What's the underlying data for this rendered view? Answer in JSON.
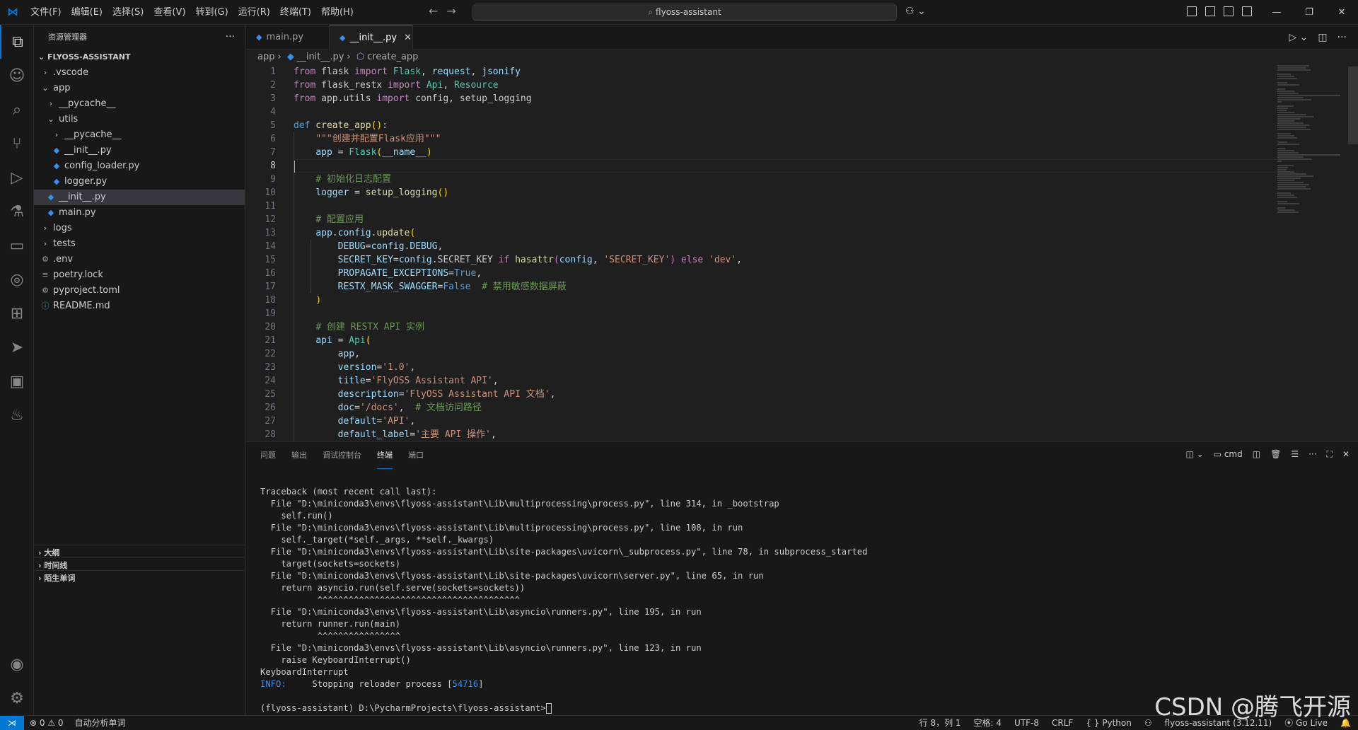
{
  "menus": [
    "文件(F)",
    "编辑(E)",
    "选择(S)",
    "查看(V)",
    "转到(G)",
    "运行(R)",
    "终端(T)",
    "帮助(H)"
  ],
  "search": {
    "text": "flyoss-assistant"
  },
  "sidebar": {
    "title": "资源管理器",
    "root": "FLYOSS-ASSISTANT",
    "items": [
      {
        "label": ".vscode",
        "depth": 1,
        "type": "folder",
        "open": false
      },
      {
        "label": "app",
        "depth": 1,
        "type": "folder",
        "open": true
      },
      {
        "label": "__pycache__",
        "depth": 2,
        "type": "folder",
        "open": false
      },
      {
        "label": "utils",
        "depth": 2,
        "type": "folder",
        "open": true
      },
      {
        "label": "__pycache__",
        "depth": 3,
        "type": "folder",
        "open": false
      },
      {
        "label": "__init__.py",
        "depth": 3,
        "type": "py"
      },
      {
        "label": "config_loader.py",
        "depth": 3,
        "type": "py"
      },
      {
        "label": "logger.py",
        "depth": 3,
        "type": "py"
      },
      {
        "label": "__init__.py",
        "depth": 2,
        "type": "py",
        "selected": true
      },
      {
        "label": "main.py",
        "depth": 2,
        "type": "py"
      },
      {
        "label": "logs",
        "depth": 1,
        "type": "folder",
        "open": false
      },
      {
        "label": "tests",
        "depth": 1,
        "type": "folder",
        "open": false
      },
      {
        "label": ".env",
        "depth": 1,
        "type": "gear"
      },
      {
        "label": "poetry.lock",
        "depth": 1,
        "type": "lock"
      },
      {
        "label": "pyproject.toml",
        "depth": 1,
        "type": "gear"
      },
      {
        "label": "README.md",
        "depth": 1,
        "type": "info"
      }
    ],
    "sections": [
      "大纲",
      "时间线",
      "陌生单词"
    ]
  },
  "tabs": [
    {
      "label": "main.py",
      "active": false
    },
    {
      "label": "__init__.py",
      "active": true
    }
  ],
  "breadcrumb": {
    "folder": "app",
    "file": "__init__.py",
    "symbol": "create_app"
  },
  "editor": {
    "current_line": 8,
    "lines": [
      [
        [
          "k",
          "from"
        ],
        [
          "t",
          " flask "
        ],
        [
          "k",
          "import"
        ],
        [
          "c",
          " Flask"
        ],
        [
          "t",
          ", "
        ],
        [
          "v",
          "request"
        ],
        [
          "t",
          ", "
        ],
        [
          "v",
          "jsonify"
        ]
      ],
      [
        [
          "k",
          "from"
        ],
        [
          "t",
          " flask_restx "
        ],
        [
          "k",
          "import"
        ],
        [
          "c",
          " Api"
        ],
        [
          "t",
          ", "
        ],
        [
          "c",
          "Resource"
        ]
      ],
      [
        [
          "k",
          "from"
        ],
        [
          "t",
          " app.utils "
        ],
        [
          "k",
          "import"
        ],
        [
          "t",
          " config, setup_logging"
        ]
      ],
      [],
      [
        [
          "d",
          "def"
        ],
        [
          "f",
          " create_app"
        ],
        [
          "b1",
          "()"
        ],
        [
          "t",
          ":"
        ]
      ],
      [
        [
          "t",
          "    "
        ],
        [
          "s",
          "\"\"\"创建并配置Flask应用\"\"\""
        ]
      ],
      [
        [
          "t",
          "    "
        ],
        [
          "v",
          "app"
        ],
        [
          "t",
          " = "
        ],
        [
          "c",
          "Flask"
        ],
        [
          "b1",
          "("
        ],
        [
          "v",
          "__name__"
        ],
        [
          "b1",
          ")"
        ]
      ],
      [],
      [
        [
          "t",
          "    "
        ],
        [
          "cm",
          "# 初始化日志配置"
        ]
      ],
      [
        [
          "t",
          "    "
        ],
        [
          "v",
          "logger"
        ],
        [
          "t",
          " = "
        ],
        [
          "f",
          "setup_logging"
        ],
        [
          "b1",
          "()"
        ]
      ],
      [],
      [
        [
          "t",
          "    "
        ],
        [
          "cm",
          "# 配置应用"
        ]
      ],
      [
        [
          "t",
          "    "
        ],
        [
          "v",
          "app"
        ],
        [
          "t",
          "."
        ],
        [
          "v",
          "config"
        ],
        [
          "t",
          "."
        ],
        [
          "f",
          "update"
        ],
        [
          "b1",
          "("
        ]
      ],
      [
        [
          "t",
          "        "
        ],
        [
          "v",
          "DEBUG"
        ],
        [
          "t",
          "="
        ],
        [
          "v",
          "config"
        ],
        [
          "t",
          "."
        ],
        [
          "v",
          "DEBUG"
        ],
        [
          "t",
          ","
        ]
      ],
      [
        [
          "t",
          "        "
        ],
        [
          "v",
          "SECRET_KEY"
        ],
        [
          "t",
          "="
        ],
        [
          "v",
          "config"
        ],
        [
          "t",
          ".SECRET_KEY "
        ],
        [
          "k",
          "if"
        ],
        [
          "f",
          " hasattr"
        ],
        [
          "b2",
          "("
        ],
        [
          "v",
          "config"
        ],
        [
          "t",
          ", "
        ],
        [
          "s",
          "'SECRET_KEY'"
        ],
        [
          "b2",
          ")"
        ],
        [
          "k",
          " else"
        ],
        [
          "s",
          " 'dev'"
        ],
        [
          "t",
          ","
        ]
      ],
      [
        [
          "t",
          "        "
        ],
        [
          "v",
          "PROPAGATE_EXCEPTIONS"
        ],
        [
          "t",
          "="
        ],
        [
          "d",
          "True"
        ],
        [
          "t",
          ","
        ]
      ],
      [
        [
          "t",
          "        "
        ],
        [
          "v",
          "RESTX_MASK_SWAGGER"
        ],
        [
          "t",
          "="
        ],
        [
          "d",
          "False"
        ],
        [
          "t",
          "  "
        ],
        [
          "cm",
          "# 禁用敏感数据屏蔽"
        ]
      ],
      [
        [
          "t",
          "    "
        ],
        [
          "b1",
          ")"
        ]
      ],
      [],
      [
        [
          "t",
          "    "
        ],
        [
          "cm",
          "# 创建 RESTX API 实例"
        ]
      ],
      [
        [
          "t",
          "    "
        ],
        [
          "v",
          "api"
        ],
        [
          "t",
          " = "
        ],
        [
          "c",
          "Api"
        ],
        [
          "b1",
          "("
        ]
      ],
      [
        [
          "t",
          "        "
        ],
        [
          "v",
          "app"
        ],
        [
          "t",
          ","
        ]
      ],
      [
        [
          "t",
          "        "
        ],
        [
          "v",
          "version"
        ],
        [
          "t",
          "="
        ],
        [
          "s",
          "'1.0'"
        ],
        [
          "t",
          ","
        ]
      ],
      [
        [
          "t",
          "        "
        ],
        [
          "v",
          "title"
        ],
        [
          "t",
          "="
        ],
        [
          "s",
          "'FlyOSS Assistant API'"
        ],
        [
          "t",
          ","
        ]
      ],
      [
        [
          "t",
          "        "
        ],
        [
          "v",
          "description"
        ],
        [
          "t",
          "="
        ],
        [
          "s",
          "'FlyOSS Assistant API 文档'"
        ],
        [
          "t",
          ","
        ]
      ],
      [
        [
          "t",
          "        "
        ],
        [
          "v",
          "doc"
        ],
        [
          "t",
          "="
        ],
        [
          "s",
          "'/docs'"
        ],
        [
          "t",
          ",  "
        ],
        [
          "cm",
          "# 文档访问路径"
        ]
      ],
      [
        [
          "t",
          "        "
        ],
        [
          "v",
          "default"
        ],
        [
          "t",
          "="
        ],
        [
          "s",
          "'API'"
        ],
        [
          "t",
          ","
        ]
      ],
      [
        [
          "t",
          "        "
        ],
        [
          "v",
          "default_label"
        ],
        [
          "t",
          "="
        ],
        [
          "s",
          "'主要 API 操作'"
        ],
        [
          "t",
          ","
        ]
      ]
    ]
  },
  "panel": {
    "tabs": [
      {
        "label": "问题",
        "active": false
      },
      {
        "label": "输出",
        "active": false
      },
      {
        "label": "调试控制台",
        "active": false
      },
      {
        "label": "终端",
        "active": true
      },
      {
        "label": "端口",
        "active": false
      }
    ],
    "shell": "cmd",
    "terminal_lines": [
      "Traceback (most recent call last):",
      "  File \"D:\\miniconda3\\envs\\flyoss-assistant\\Lib\\multiprocessing\\process.py\", line 314, in _bootstrap",
      "    self.run()",
      "  File \"D:\\miniconda3\\envs\\flyoss-assistant\\Lib\\multiprocessing\\process.py\", line 108, in run",
      "    self._target(*self._args, **self._kwargs)",
      "  File \"D:\\miniconda3\\envs\\flyoss-assistant\\Lib\\site-packages\\uvicorn\\_subprocess.py\", line 78, in subprocess_started",
      "    target(sockets=sockets)",
      "  File \"D:\\miniconda3\\envs\\flyoss-assistant\\Lib\\site-packages\\uvicorn\\server.py\", line 65, in run",
      "    return asyncio.run(self.serve(sockets=sockets))",
      "           ^^^^^^^^^^^^^^^^^^^^^^^^^^^^^^^^^^^^^^^",
      "  File \"D:\\miniconda3\\envs\\flyoss-assistant\\Lib\\asyncio\\runners.py\", line 195, in run",
      "    return runner.run(main)",
      "           ^^^^^^^^^^^^^^^^",
      "  File \"D:\\miniconda3\\envs\\flyoss-assistant\\Lib\\asyncio\\runners.py\", line 123, in run",
      "    raise KeyboardInterrupt()",
      "KeyboardInterrupt"
    ],
    "info_label": "INFO:",
    "info_text": "     Stopping reloader process [",
    "info_pid": "54716",
    "info_end": "]",
    "prompt": "(flyoss-assistant) D:\\PycharmProjects\\flyoss-assistant>"
  },
  "statusbar": {
    "problems": "⊗ 0 ⚠ 0",
    "auto_analysis": "自动分析单词",
    "position": "行 8，列 1",
    "spaces": "空格: 4",
    "encoding": "UTF-8",
    "eol": "CRLF",
    "language": "{ } Python",
    "interpreter": "flyoss-assistant (3.12.11)",
    "golive": "Go Live"
  },
  "watermark": "CSDN @腾飞开源"
}
